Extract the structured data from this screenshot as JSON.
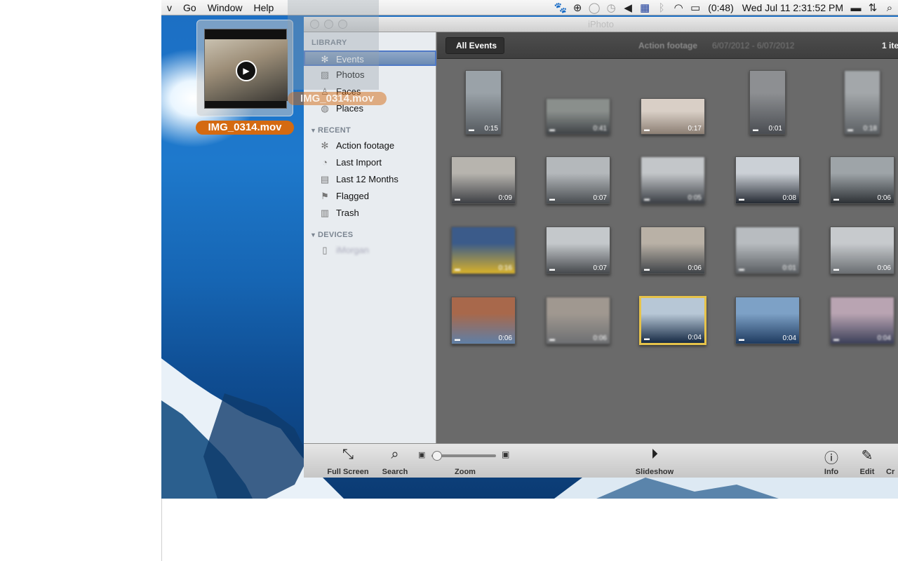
{
  "menubar": {
    "items": [
      "v",
      "Go",
      "Window",
      "Help"
    ],
    "status": {
      "battery": "(0:48)",
      "clock": "Wed Jul 11  2:31:52 PM"
    }
  },
  "dragged_file": {
    "name": "IMG_0314.mov",
    "ghost_name": "IMG_0314.mov"
  },
  "window": {
    "title": "iPhoto"
  },
  "sidebar": {
    "library_header": "LIBRARY",
    "library": [
      {
        "label": "Events",
        "icon": "palm-tree-icon"
      },
      {
        "label": "Photos",
        "icon": "photo-icon"
      },
      {
        "label": "Faces",
        "icon": "person-icon"
      },
      {
        "label": "Places",
        "icon": "globe-icon"
      }
    ],
    "recent_header": "RECENT",
    "recent": [
      {
        "label": "Action footage",
        "icon": "palm-tree-icon"
      },
      {
        "label": "Last Import",
        "icon": "clock-icon"
      },
      {
        "label": "Last 12 Months",
        "icon": "calendar-icon"
      },
      {
        "label": "Flagged",
        "icon": "flag-icon"
      },
      {
        "label": "Trash",
        "icon": "trash-icon"
      }
    ],
    "devices_header": "DEVICES",
    "devices": [
      {
        "label": "iMorgan",
        "icon": "phone-icon"
      }
    ]
  },
  "content": {
    "back_button": "All Events",
    "event_title": "Action footage",
    "event_dates": "6/07/2012 - 6/07/2012",
    "count": "1 ite"
  },
  "thumbnails": [
    {
      "dur": "0:15"
    },
    {
      "dur": "0:41"
    },
    {
      "dur": "0:17"
    },
    {
      "dur": "0:01"
    },
    {
      "dur": "0:18"
    },
    {
      "dur": "0:09"
    },
    {
      "dur": "0:07"
    },
    {
      "dur": "0:05"
    },
    {
      "dur": "0:08"
    },
    {
      "dur": "0:06"
    },
    {
      "dur": "0:16"
    },
    {
      "dur": "0:07"
    },
    {
      "dur": "0:06"
    },
    {
      "dur": "0:01"
    },
    {
      "dur": "0:06"
    },
    {
      "dur": "0:06"
    },
    {
      "dur": "0:06"
    },
    {
      "dur": "0:04"
    },
    {
      "dur": "0:04"
    },
    {
      "dur": "0:04"
    }
  ],
  "toolbar": {
    "fullscreen": "Full Screen",
    "search": "Search",
    "zoom": "Zoom",
    "slideshow": "Slideshow",
    "info": "Info",
    "edit": "Edit",
    "create": "Cr"
  },
  "colors": {
    "selection_highlight": "#e6c34a",
    "drag_label": "#d46a11",
    "sidebar_selected": "#6b8ab3"
  }
}
